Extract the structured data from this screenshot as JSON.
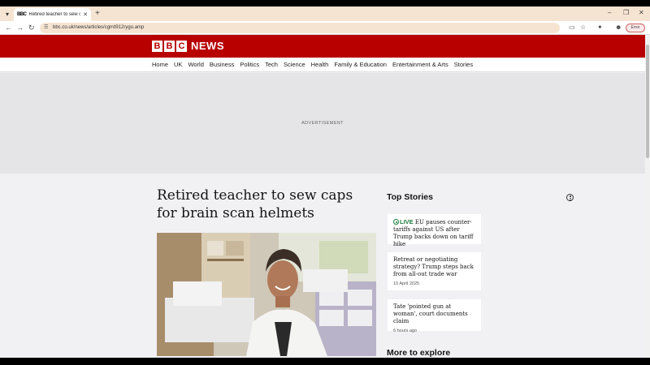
{
  "browser": {
    "tab_title": "Retired teacher to sew caps fo",
    "tab_favicon": "BBC",
    "url": "bbc.co.uk/news/articles/cgrrd912rygo.amp",
    "error_label": "Error"
  },
  "header": {
    "logo_letters": [
      "B",
      "B",
      "C"
    ],
    "logo_word": "NEWS"
  },
  "nav": {
    "items": [
      "Home",
      "UK",
      "World",
      "Business",
      "Politics",
      "Tech",
      "Science",
      "Health",
      "Family & Education",
      "Entertainment & Arts",
      "Stories"
    ]
  },
  "ad": {
    "label": "ADVERTISEMENT"
  },
  "article": {
    "headline": "Retired teacher to sew caps for brain scan helmets"
  },
  "top_stories": {
    "title": "Top Stories",
    "items": [
      {
        "live": "LIVE",
        "headline": "EU pauses counter-tariffs against US after Trump backs down on tariff hike",
        "time": ""
      },
      {
        "live": "",
        "headline": "Retreat or negotiating strategy? Trump steps back from all-out trade war",
        "time": "10 April 2025"
      },
      {
        "live": "",
        "headline": "Tate 'pointed gun at woman', court documents claim",
        "time": "6 hours ago"
      }
    ]
  },
  "more_to_explore": {
    "title": "More to explore"
  },
  "colors": {
    "bbc_red": "#b80000",
    "live_green": "#1d7c3b",
    "tab_bar": "#f6e4d2"
  }
}
